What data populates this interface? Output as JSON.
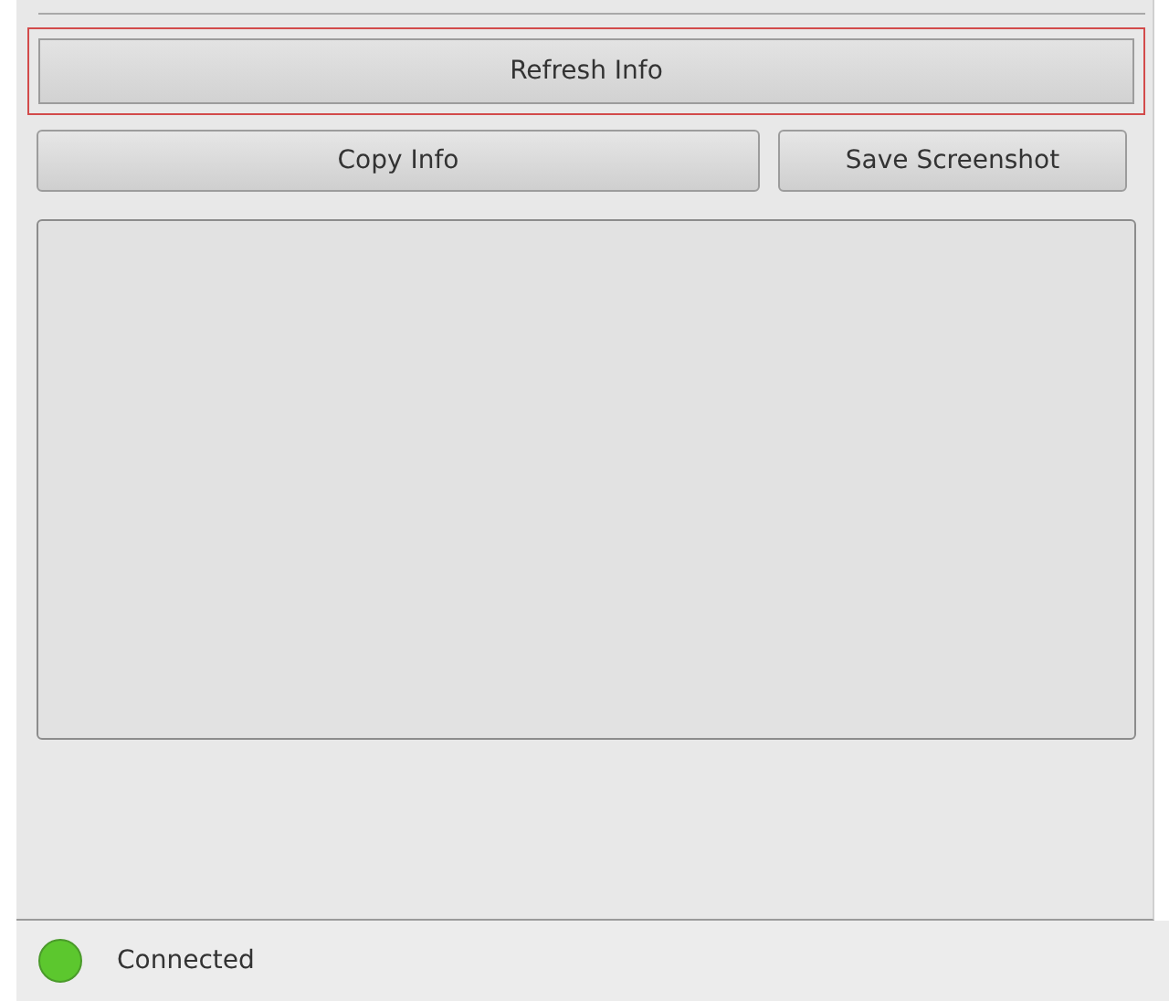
{
  "buttons": [
    {
      "label": "Refresh Info",
      "focused": true
    },
    {
      "label": "Copy Info",
      "focused": false
    },
    {
      "label": "Save Screenshot",
      "focused": false
    }
  ],
  "status": {
    "text": "Connected",
    "color": "#5cc72e"
  }
}
